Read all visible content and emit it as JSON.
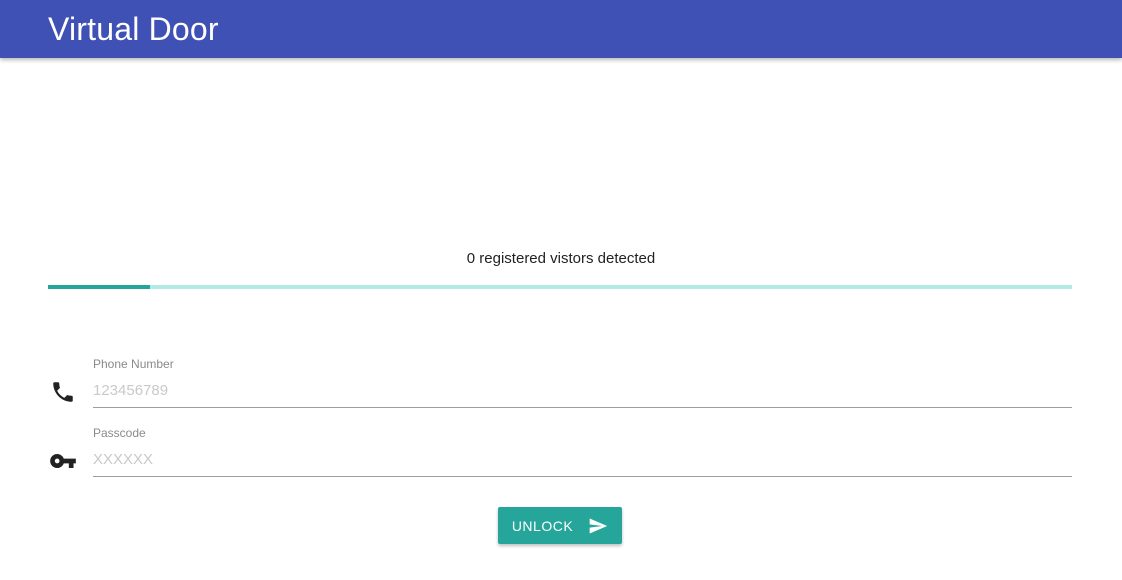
{
  "header": {
    "title": "Virtual Door"
  },
  "status": {
    "text": "0 registered vistors detected",
    "progress_fraction": 0.1
  },
  "form": {
    "phone": {
      "label": "Phone Number",
      "placeholder": "123456789",
      "value": "",
      "icon": "phone-icon"
    },
    "passcode": {
      "label": "Passcode",
      "placeholder": "XXXXXX",
      "value": "",
      "icon": "key-icon"
    },
    "unlock_button": {
      "label": "UNLOCK",
      "icon": "send-icon"
    }
  },
  "colors": {
    "header_bg": "#3f51b5",
    "accent": "#26a69a",
    "progress_track": "#b2ebe6",
    "icon": "#222222"
  }
}
